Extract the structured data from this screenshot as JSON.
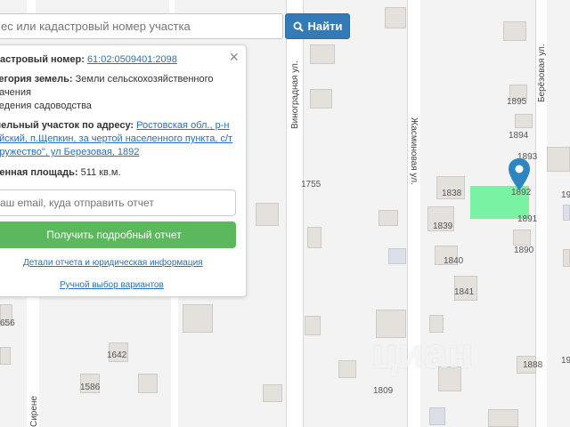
{
  "search": {
    "placeholder": "ес или кадастровый номер участка",
    "button_label": "Найти"
  },
  "panel": {
    "cadastral_label": "дастровый номер:",
    "cadastral_value": "61:02:0509401:2098",
    "category_label": "тегория земель:",
    "category_value_1": "Земли сельскохозяйственного",
    "category_value_2": "начения",
    "usage_text": "ведения садоводства",
    "address_label": "мельный участок по адресу:",
    "address_line_1": "Ростовская обл., р-н",
    "address_line_2": "айский, п.Щепкин, за чертой населенного пункта, с/т",
    "address_line_3": "дружество\", ул Березовая, 1892",
    "area_label": "ченная площадь:",
    "area_value": "511 кв.м.",
    "email_placeholder": "аш email, куда отправить отчет",
    "report_button": "Получить подробный отчет",
    "details_link": "Детали отчета и юридическая информация",
    "manual_link": "Ручной выбор вариантов",
    "close_icon": "×"
  },
  "map": {
    "streets": [
      "Виноградная ул.",
      "Жасминовая ул.",
      "Берёзовая ул.",
      "Сирене"
    ],
    "house_numbers": [
      "1895",
      "1894",
      "1893",
      "1892",
      "1838",
      "1839",
      "1891",
      "1890",
      "1840",
      "1841",
      "1755",
      "1642",
      "1586",
      "1809",
      "1888",
      "656",
      "19",
      "19"
    ],
    "watermark": "циан",
    "parcel_color": "#6ff29c",
    "pin_color": "#2e86c1",
    "icons": [
      "search-icon",
      "close-icon",
      "map-pin-icon"
    ]
  }
}
